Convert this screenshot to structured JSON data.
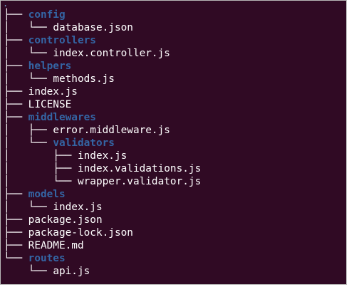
{
  "root_label": ".",
  "tree": [
    {
      "prefix": "├── ",
      "name": "config",
      "type": "dir"
    },
    {
      "prefix": "│   └── ",
      "name": "database.json",
      "type": "file"
    },
    {
      "prefix": "├── ",
      "name": "controllers",
      "type": "dir"
    },
    {
      "prefix": "│   └── ",
      "name": "index.controller.js",
      "type": "file"
    },
    {
      "prefix": "├── ",
      "name": "helpers",
      "type": "dir"
    },
    {
      "prefix": "│   └── ",
      "name": "methods.js",
      "type": "file"
    },
    {
      "prefix": "├── ",
      "name": "index.js",
      "type": "file"
    },
    {
      "prefix": "├── ",
      "name": "LICENSE",
      "type": "file"
    },
    {
      "prefix": "├── ",
      "name": "middlewares",
      "type": "dir"
    },
    {
      "prefix": "│   ├── ",
      "name": "error.middleware.js",
      "type": "file"
    },
    {
      "prefix": "│   └── ",
      "name": "validators",
      "type": "dir"
    },
    {
      "prefix": "│       ├── ",
      "name": "index.js",
      "type": "file"
    },
    {
      "prefix": "│       ├── ",
      "name": "index.validations.js",
      "type": "file"
    },
    {
      "prefix": "│       └── ",
      "name": "wrapper.validator.js",
      "type": "file"
    },
    {
      "prefix": "├── ",
      "name": "models",
      "type": "dir"
    },
    {
      "prefix": "│   └── ",
      "name": "index.js",
      "type": "file"
    },
    {
      "prefix": "├── ",
      "name": "package.json",
      "type": "file"
    },
    {
      "prefix": "├── ",
      "name": "package-lock.json",
      "type": "file"
    },
    {
      "prefix": "├── ",
      "name": "README.md",
      "type": "file"
    },
    {
      "prefix": "└── ",
      "name": "routes",
      "type": "dir"
    },
    {
      "prefix": "    └── ",
      "name": "api.js",
      "type": "file"
    }
  ],
  "colors": {
    "background": "#300a24",
    "directory": "#3465a4",
    "file": "#ffffff"
  }
}
